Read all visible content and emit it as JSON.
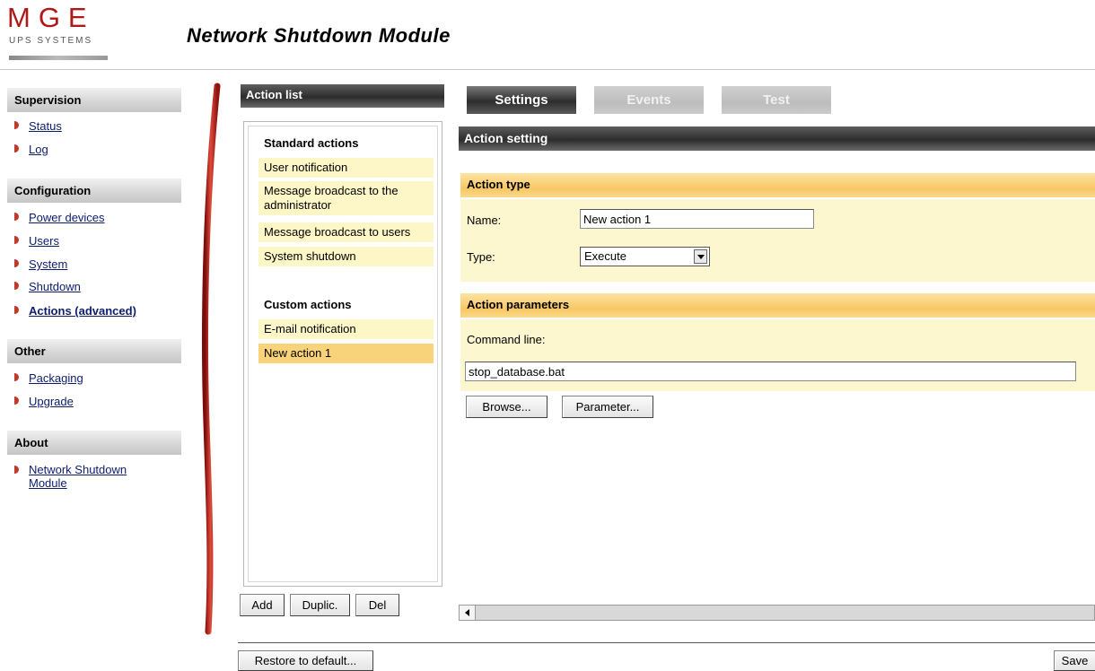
{
  "header": {
    "logo_letters": "MGE",
    "logo_sub": "UPS SYSTEMS",
    "title": "Network Shutdown Module"
  },
  "sidebar": {
    "sections": [
      {
        "title": "Supervision",
        "items": [
          "Status",
          "Log"
        ]
      },
      {
        "title": "Configuration",
        "items": [
          "Power devices",
          "Users",
          "System",
          "Shutdown",
          "Actions (advanced)"
        ]
      },
      {
        "title": "Other",
        "items": [
          "Packaging",
          "Upgrade"
        ]
      },
      {
        "title": "About",
        "items": [
          "Network Shutdown Module"
        ]
      }
    ],
    "active_item": "Actions (advanced)"
  },
  "action_list": {
    "title": "Action list",
    "standard_title": "Standard actions",
    "standard": [
      "User notification",
      "Message broadcast to the administrator",
      "Message broadcast to users",
      "System shutdown"
    ],
    "custom_title": "Custom actions",
    "custom": [
      "E-mail notification",
      "New action 1"
    ],
    "selected": "New action 1",
    "add_label": "Add",
    "duplicate_label": "Duplic.",
    "delete_label": "Del"
  },
  "tabs": [
    {
      "label": "Settings",
      "active": true
    },
    {
      "label": "Events",
      "active": false
    },
    {
      "label": "Test",
      "active": false
    }
  ],
  "settings": {
    "title": "Action setting",
    "type_section": "Action type",
    "name_label": "Name:",
    "name_value": "New action 1",
    "type_label": "Type:",
    "type_value": "Execute",
    "params_section": "Action parameters",
    "command_label": "Command line:",
    "command_value": "stop_database.bat",
    "browse_label": "Browse...",
    "parameter_label": "Parameter..."
  },
  "footer": {
    "restore_label": "Restore to default...",
    "save_label": "Save"
  },
  "colors": {
    "accent_red": "#c03a2a",
    "link": "#0c1d6d",
    "selected_row": "#f8d37a",
    "row": "#fdf7c7",
    "orange_header": "#f8c765"
  }
}
